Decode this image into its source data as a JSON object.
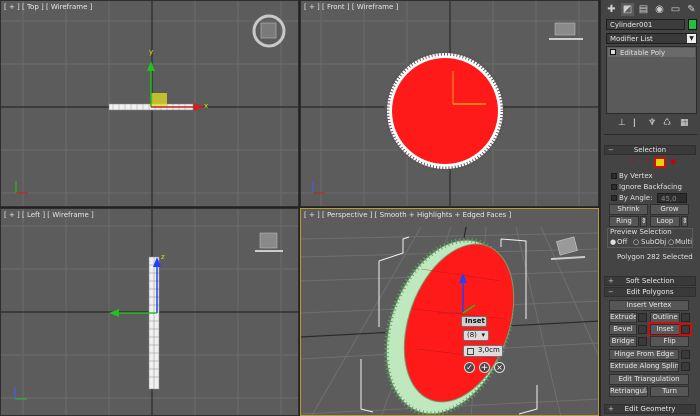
{
  "viewports": {
    "top_label": "[ + ] [ Top ] [ Wireframe ]",
    "front_label": "[ + ] [ Front ] [ Wireframe ]",
    "left_label": "[ + ] [ Left ] [ Wireframe ]",
    "persp_label": "[ + ] [ Perspective ] [ Smooth + Highlights + Edged Faces ]",
    "axis_y": "y",
    "axis_x": "x",
    "axis_z": "z"
  },
  "hud": {
    "title": "Inset",
    "mode": "(8)",
    "amount": "3,0cm"
  },
  "panel": {
    "object_name": "Cylinder001",
    "modifier_list": "Modifier List",
    "stack_item": "Editable Poly",
    "object_color": "#22c040",
    "selection_header": "Selection",
    "by_vertex": "By Vertex",
    "ignore_backfacing": "Ignore Backfacing",
    "by_angle": "By Angle:",
    "by_angle_value": "45,0",
    "shrink": "Shrink",
    "grow": "Grow",
    "ring": "Ring",
    "loop": "Loop",
    "preview_selection": "Preview Selection",
    "preview_off": "Off",
    "preview_subobj": "SubObj",
    "preview_multi": "Multi",
    "selected_status": "Polygon 282 Selected",
    "soft_selection": "Soft Selection",
    "edit_polygons": "Edit Polygons",
    "insert_vertex": "Insert Vertex",
    "extrude": "Extrude",
    "outline": "Outline",
    "bevel": "Bevel",
    "inset": "Inset",
    "bridge": "Bridge",
    "flip": "Flip",
    "hinge_from_edge": "Hinge From Edge",
    "extrude_along_spline": "Extrude Along Spline",
    "edit_triangulation": "Edit Triangulation",
    "retriangulate": "Retriangulate",
    "turn": "Turn",
    "edit_geometry": "Edit Geometry",
    "highlight_color": "#c81010",
    "selected_poly_color": "#ff1a1a"
  }
}
